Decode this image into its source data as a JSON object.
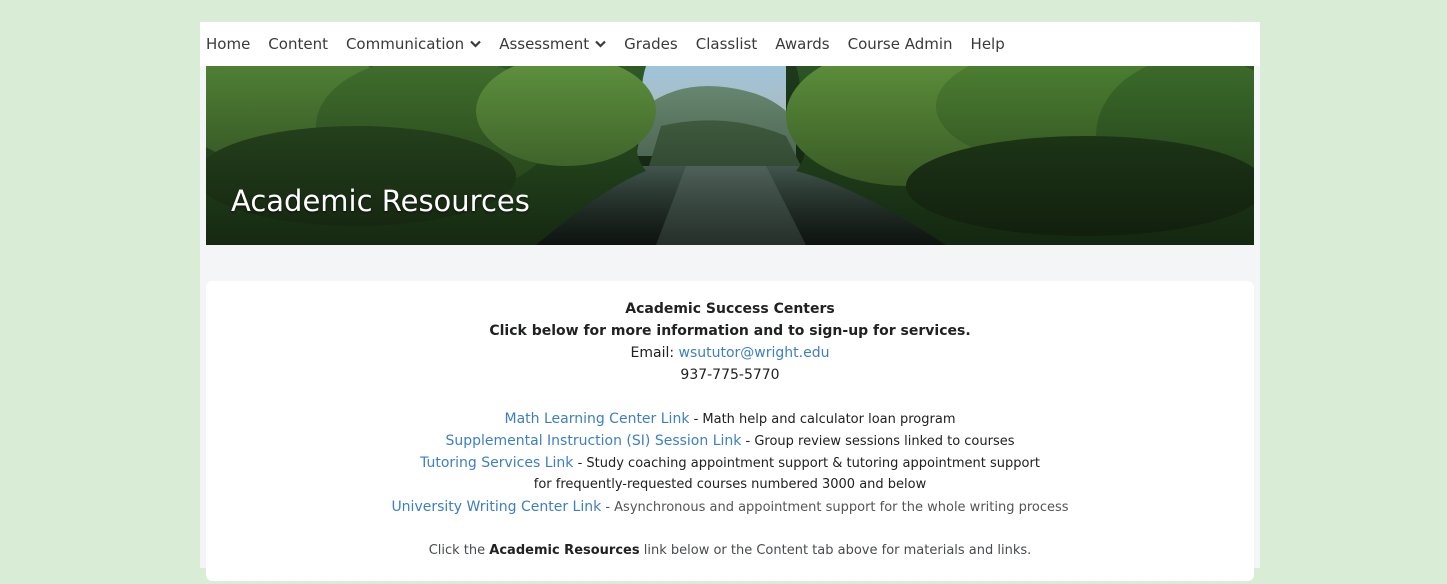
{
  "nav": {
    "items": [
      {
        "label": "Home"
      },
      {
        "label": "Content"
      },
      {
        "label": "Communication",
        "dropdown": true
      },
      {
        "label": "Assessment",
        "dropdown": true
      },
      {
        "label": "Grades"
      },
      {
        "label": "Classlist"
      },
      {
        "label": "Awards"
      },
      {
        "label": "Course Admin"
      },
      {
        "label": "Help"
      }
    ]
  },
  "banner": {
    "title": "Academic Resources",
    "image": "river-forest-image"
  },
  "content": {
    "heading": "Academic Success Centers",
    "subheading": "Click below for more information and to sign-up for services.",
    "email_label": "Email:",
    "email_link": "wsututor@wright.edu",
    "phone": "937-775-5770",
    "resources": [
      {
        "link": "Math Learning Center Link",
        "desc": "- Math help and calculator loan program"
      },
      {
        "link": "Supplemental Instruction (SI) Session Link",
        "desc": " - Group review sessions linked to courses"
      },
      {
        "link": "Tutoring Services Link",
        "desc": " - Study coaching appointment support & tutoring appointment support"
      },
      {
        "continuation": "for frequently-requested courses numbered 3000 and below"
      },
      {
        "link": "University Writing Center Link",
        "desc": "- Asynchronous and appointment support for the whole writing process"
      }
    ],
    "footer": {
      "prefix": "Click the",
      "bold": "Academic Resources",
      "suffix": "link below or the Content tab above for materials and links."
    }
  },
  "colors": {
    "page_bg": "#d9ecd5",
    "link": "#3d7fc3",
    "text": "#202122"
  }
}
